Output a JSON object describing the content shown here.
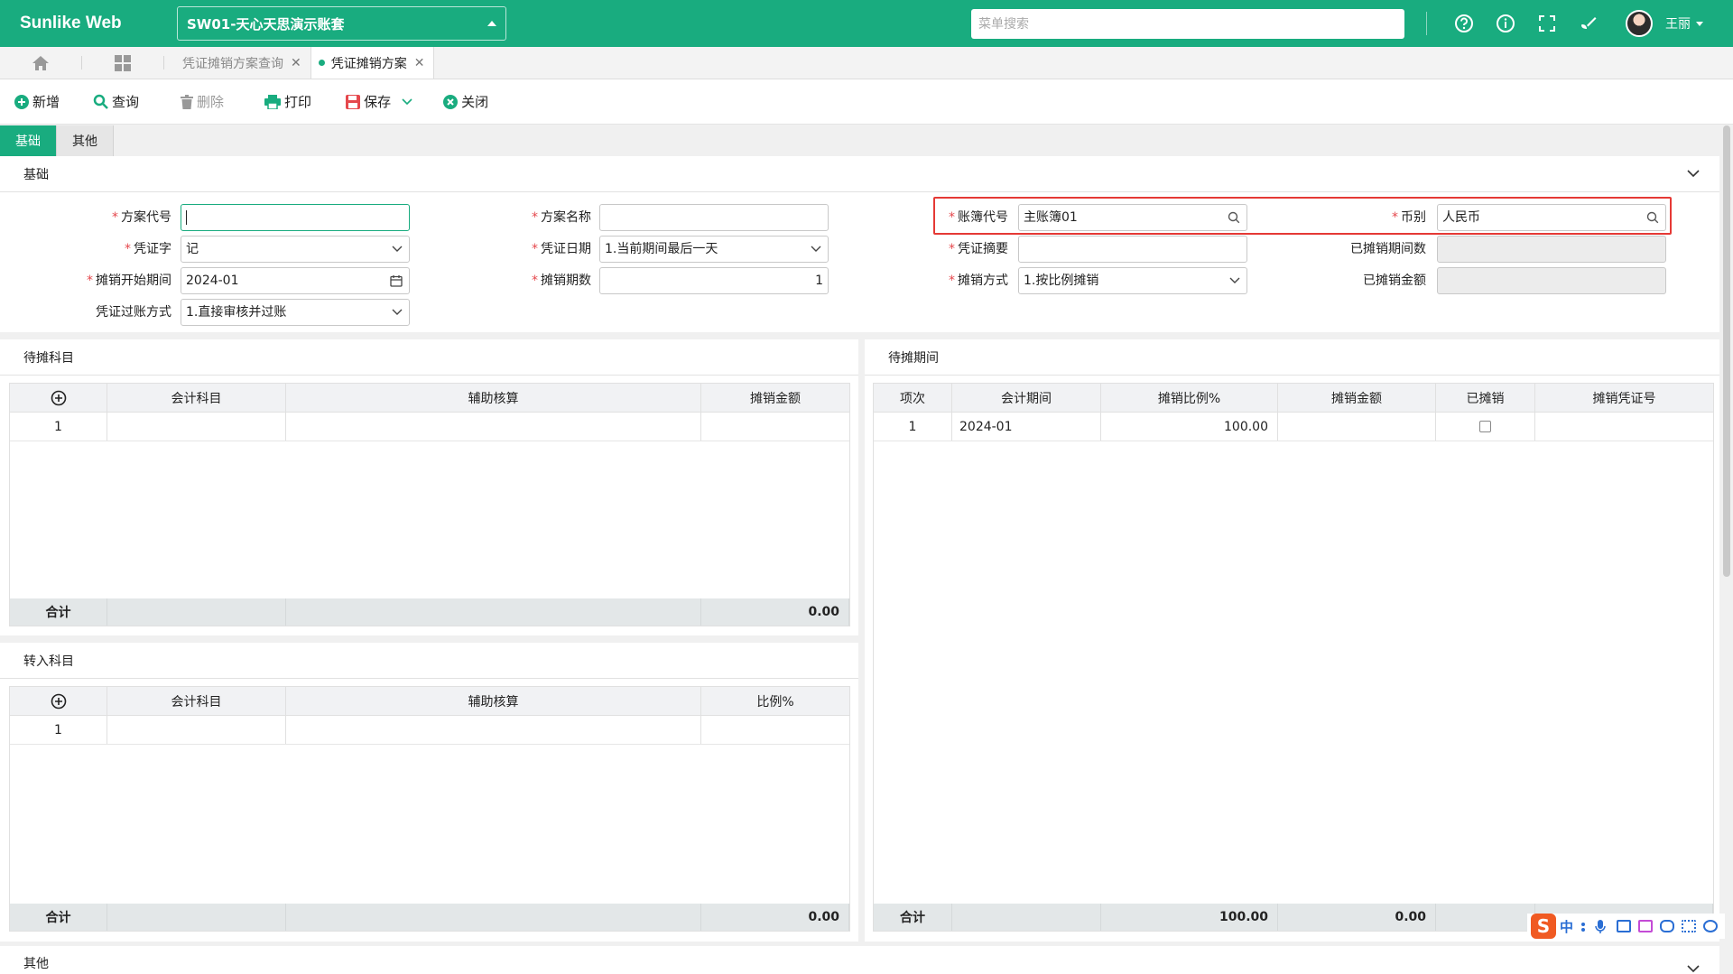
{
  "app": {
    "brand": "Sunlike Web",
    "account": "SW01-天心天思演示账套",
    "menu_search_placeholder": "菜单搜索",
    "user_name": "王丽",
    "accent_color": "#19ac7f"
  },
  "tabs": [
    {
      "label": "凭证摊销方案查询",
      "active": false
    },
    {
      "label": "凭证摊销方案",
      "active": true
    }
  ],
  "toolbar": {
    "new": "新增",
    "query": "查询",
    "delete": "删除",
    "print": "打印",
    "save": "保存",
    "close": "关闭"
  },
  "form_tabs": [
    "基础",
    "其他"
  ],
  "basic": {
    "section_title": "基础",
    "fields": {
      "plan_code": {
        "label": "方案代号",
        "value": ""
      },
      "plan_name": {
        "label": "方案名称",
        "value": ""
      },
      "ledger_code": {
        "label": "账簿代号",
        "value": "主账簿01"
      },
      "currency": {
        "label": "币别",
        "value": "人民币"
      },
      "voucher_word": {
        "label": "凭证字",
        "value": "记"
      },
      "voucher_date": {
        "label": "凭证日期",
        "value": "1.当前期间最后一天"
      },
      "voucher_summary": {
        "label": "凭证摘要",
        "value": ""
      },
      "amortized_periods": {
        "label": "已摊销期间数",
        "value": ""
      },
      "start_period": {
        "label": "摊销开始期间",
        "value": "2024-01"
      },
      "periods": {
        "label": "摊销期数",
        "value": "1"
      },
      "method": {
        "label": "摊销方式",
        "value": "1.按比例摊销"
      },
      "amortized_amount": {
        "label": "已摊销金额",
        "value": ""
      },
      "posting_method": {
        "label": "凭证过账方式",
        "value": "1.直接审核并过账"
      }
    }
  },
  "pending_subjects": {
    "title": "待摊科目",
    "columns": [
      "会计科目",
      "辅助核算",
      "摊销金额"
    ],
    "rows": [
      {
        "no": "1",
        "subject": "",
        "aux": "",
        "amount": ""
      }
    ],
    "total_label": "合计",
    "total_amount": "0.00"
  },
  "transfer_subjects": {
    "title": "转入科目",
    "columns": [
      "会计科目",
      "辅助核算",
      "比例%"
    ],
    "rows": [
      {
        "no": "1",
        "subject": "",
        "aux": "",
        "ratio": ""
      }
    ],
    "total_label": "合计",
    "total_value": "0.00"
  },
  "pending_periods": {
    "title": "待摊期间",
    "columns": [
      "项次",
      "会计期间",
      "摊销比例%",
      "摊销金额",
      "已摊销",
      "摊销凭证号"
    ],
    "rows": [
      {
        "no": "1",
        "period": "2024-01",
        "ratio": "100.00",
        "amount": "",
        "amortized": false,
        "voucher_no": ""
      }
    ],
    "total_label": "合计",
    "total_ratio": "100.00",
    "total_amount": "0.00"
  },
  "other_section": {
    "title": "其他"
  },
  "ime": {
    "lang": "中"
  }
}
